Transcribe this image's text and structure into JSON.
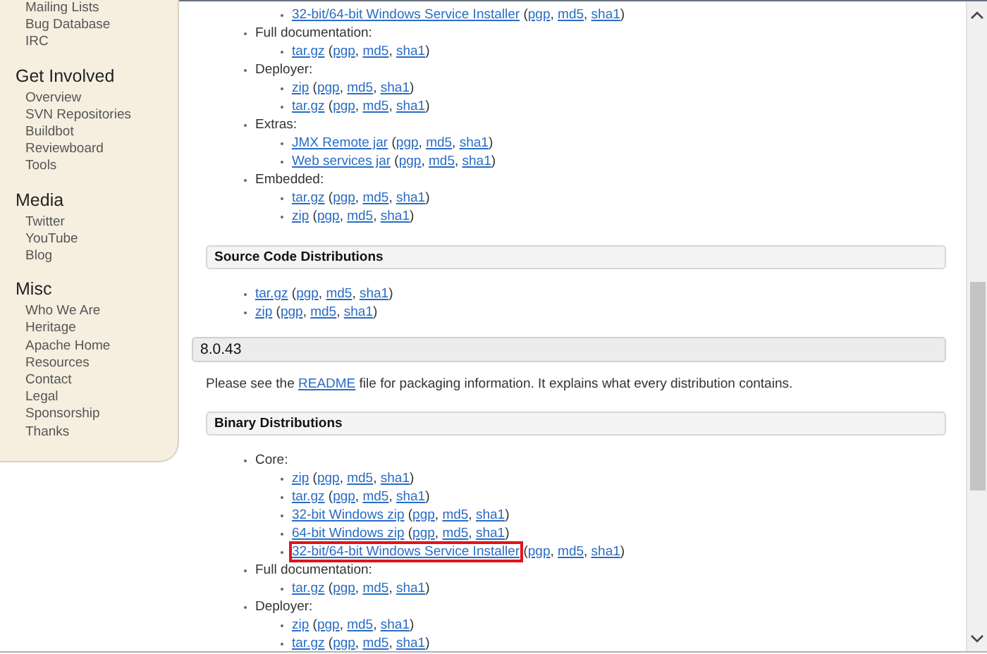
{
  "sidebar": {
    "sections": [
      {
        "items": [
          "Mailing Lists",
          "Bug Database",
          "IRC"
        ]
      },
      {
        "heading": "Get Involved",
        "items": [
          "Overview",
          "SVN Repositories",
          "Buildbot",
          "Reviewboard",
          "Tools"
        ]
      },
      {
        "heading": "Media",
        "items": [
          "Twitter",
          "YouTube",
          "Blog"
        ]
      },
      {
        "heading": "Misc",
        "items": [
          "Who We Are",
          "Heritage",
          "Apache Home",
          "Resources",
          "Contact",
          "Legal",
          "Sponsorship",
          "Thanks"
        ]
      }
    ]
  },
  "punctuation": {
    "open": " (",
    "sep": ", ",
    "close": ")"
  },
  "main": [
    {
      "kind": "list",
      "items": [
        {
          "children": [
            {
              "file": "32-bit/64-bit Windows Service Installer",
              "sigs": [
                "pgp",
                "md5",
                "sha1"
              ],
              "highlighted": false
            }
          ]
        },
        {
          "label": "Full documentation:",
          "children": [
            {
              "file": "tar.gz",
              "sigs": [
                "pgp",
                "md5",
                "sha1"
              ],
              "highlighted": false
            }
          ]
        },
        {
          "label": "Deployer:",
          "children": [
            {
              "file": "zip",
              "sigs": [
                "pgp",
                "md5",
                "sha1"
              ],
              "highlighted": false
            },
            {
              "file": "tar.gz",
              "sigs": [
                "pgp",
                "md5",
                "sha1"
              ],
              "highlighted": false
            }
          ]
        },
        {
          "label": "Extras:",
          "children": [
            {
              "file": "JMX Remote jar",
              "sigs": [
                "pgp",
                "md5",
                "sha1"
              ],
              "highlighted": false
            },
            {
              "file": "Web services jar",
              "sigs": [
                "pgp",
                "md5",
                "sha1"
              ],
              "highlighted": false
            }
          ]
        },
        {
          "label": "Embedded:",
          "children": [
            {
              "file": "tar.gz",
              "sigs": [
                "pgp",
                "md5",
                "sha1"
              ],
              "highlighted": false
            },
            {
              "file": "zip",
              "sigs": [
                "pgp",
                "md5",
                "sha1"
              ],
              "highlighted": false
            }
          ]
        }
      ]
    },
    {
      "kind": "section_header",
      "text": "Source Code Distributions"
    },
    {
      "kind": "list",
      "items": [
        {
          "file": "tar.gz",
          "sigs": [
            "pgp",
            "md5",
            "sha1"
          ],
          "highlighted": false
        },
        {
          "file": "zip",
          "sigs": [
            "pgp",
            "md5",
            "sha1"
          ],
          "highlighted": false
        }
      ]
    },
    {
      "kind": "version_header",
      "text": "8.0.43"
    },
    {
      "kind": "paragraph",
      "before": "Please see the ",
      "link": "README",
      "after": " file for packaging information. It explains what every distribution contains."
    },
    {
      "kind": "section_header",
      "text": "Binary Distributions"
    },
    {
      "kind": "list",
      "items": [
        {
          "label": "Core:",
          "children": [
            {
              "file": "zip",
              "sigs": [
                "pgp",
                "md5",
                "sha1"
              ],
              "highlighted": false
            },
            {
              "file": "tar.gz",
              "sigs": [
                "pgp",
                "md5",
                "sha1"
              ],
              "highlighted": false
            },
            {
              "file": "32-bit Windows zip",
              "sigs": [
                "pgp",
                "md5",
                "sha1"
              ],
              "highlighted": false
            },
            {
              "file": "64-bit Windows zip",
              "sigs": [
                "pgp",
                "md5",
                "sha1"
              ],
              "highlighted": false
            },
            {
              "file": "32-bit/64-bit Windows Service Installer",
              "sigs": [
                "pgp",
                "md5",
                "sha1"
              ],
              "highlighted": true
            }
          ]
        },
        {
          "label": "Full documentation:",
          "children": [
            {
              "file": "tar.gz",
              "sigs": [
                "pgp",
                "md5",
                "sha1"
              ],
              "highlighted": false
            }
          ]
        },
        {
          "label": "Deployer:",
          "children": [
            {
              "file": "zip",
              "sigs": [
                "pgp",
                "md5",
                "sha1"
              ],
              "highlighted": false
            },
            {
              "file": "tar.gz",
              "sigs": [
                "pgp",
                "md5",
                "sha1"
              ],
              "highlighted": false
            }
          ]
        }
      ]
    }
  ]
}
